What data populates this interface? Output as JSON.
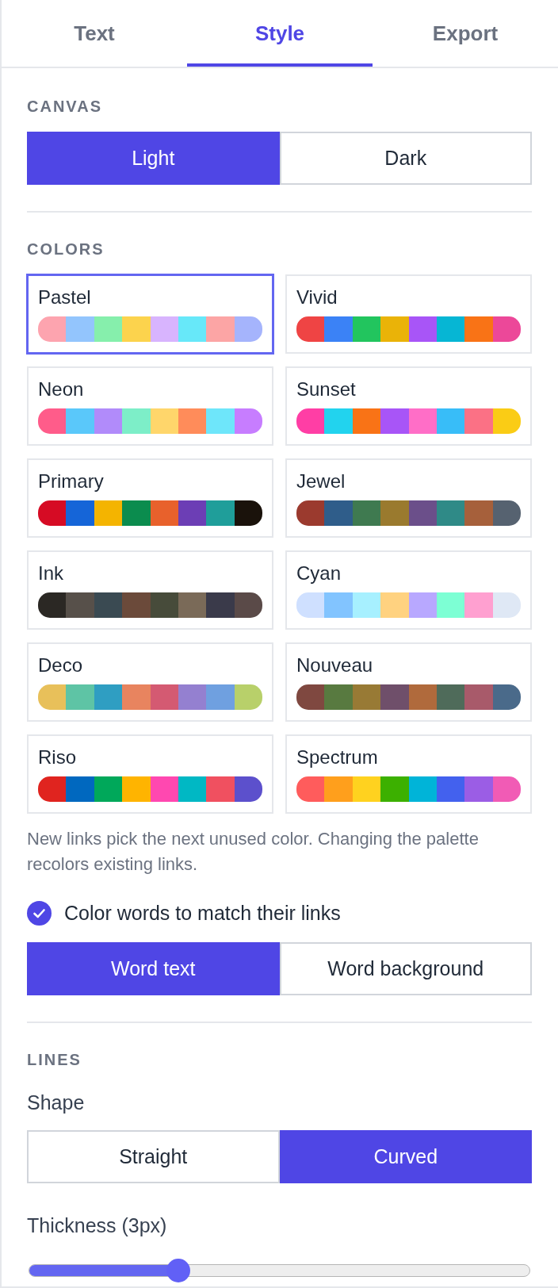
{
  "tabs": [
    {
      "label": "Text",
      "selected": false
    },
    {
      "label": "Style",
      "selected": true
    },
    {
      "label": "Export",
      "selected": false
    }
  ],
  "canvas": {
    "heading": "CANVAS",
    "options": [
      {
        "label": "Light",
        "selected": true
      },
      {
        "label": "Dark",
        "selected": false
      }
    ]
  },
  "colors": {
    "heading": "COLORS",
    "palettes": [
      {
        "name": "Pastel",
        "selected": true,
        "swatches": [
          {
            "color": "#fda4af"
          },
          {
            "color": "#93c5fd"
          },
          {
            "color": "#86efac"
          },
          {
            "color": "#fcd34d"
          },
          {
            "color": "#d8b4fe"
          },
          {
            "color": "#67e8f9"
          },
          {
            "color": "#fca5a5"
          },
          {
            "color": "#a5b4fc"
          }
        ]
      },
      {
        "name": "Vivid",
        "selected": false,
        "swatches": [
          {
            "color": "#ef4444"
          },
          {
            "color": "#3b82f6"
          },
          {
            "color": "#22c55e"
          },
          {
            "color": "#eab308"
          },
          {
            "color": "#a855f7"
          },
          {
            "color": "#06b6d4"
          },
          {
            "color": "#f97316"
          },
          {
            "color": "#ec4899"
          }
        ]
      },
      {
        "name": "Neon",
        "selected": false,
        "swatches": [
          {
            "color": "#ff5c8a"
          },
          {
            "color": "#5ac8fa"
          },
          {
            "color": "#b18bfa"
          },
          {
            "color": "#7deec8"
          },
          {
            "color": "#ffd66b"
          },
          {
            "color": "#ff8c5a"
          },
          {
            "color": "#6ee6fa"
          },
          {
            "color": "#c77dff"
          }
        ]
      },
      {
        "name": "Sunset",
        "selected": false,
        "swatches": [
          {
            "color": "#ff3ea5"
          },
          {
            "color": "#22d3ee"
          },
          {
            "color": "#f97316"
          },
          {
            "color": "#a855f7"
          },
          {
            "color": "#ff6ec7"
          },
          {
            "color": "#38bdf8"
          },
          {
            "color": "#fb7185"
          },
          {
            "color": "#facc15"
          }
        ]
      },
      {
        "name": "Primary",
        "selected": false,
        "swatches": [
          {
            "color": "#d60b24"
          },
          {
            "color": "#1565d8"
          },
          {
            "color": "#f4b400"
          },
          {
            "color": "#0b8c4e"
          },
          {
            "color": "#e8612c"
          },
          {
            "color": "#6c3eb5"
          },
          {
            "color": "#1f9e9a"
          },
          {
            "color": "#1a120b"
          }
        ]
      },
      {
        "name": "Jewel",
        "selected": false,
        "swatches": [
          {
            "color": "#9b3a2e"
          },
          {
            "color": "#2f5d8a"
          },
          {
            "color": "#3f7a50"
          },
          {
            "color": "#9a7a2e"
          },
          {
            "color": "#6b4f8a"
          },
          {
            "color": "#2f8a87"
          },
          {
            "color": "#a6603b"
          },
          {
            "color": "#566270"
          }
        ]
      },
      {
        "name": "Ink",
        "selected": false,
        "swatches": [
          {
            "color": "#2b2824"
          },
          {
            "color": "#57504a"
          },
          {
            "color": "#3a4a52"
          },
          {
            "color": "#6b4a3a"
          },
          {
            "color": "#474b3a"
          },
          {
            "color": "#7a6a58"
          },
          {
            "color": "#3a3a4a"
          },
          {
            "color": "#5a4a48"
          }
        ]
      },
      {
        "name": "Cyan",
        "selected": false,
        "swatches": [
          {
            "color": "#cfe0ff"
          },
          {
            "color": "#82c4ff"
          },
          {
            "color": "#a7f0ff"
          },
          {
            "color": "#ffd280"
          },
          {
            "color": "#b8a8ff"
          },
          {
            "color": "#7dffd4"
          },
          {
            "color": "#ffa0d0"
          },
          {
            "color": "#dfe8f5"
          }
        ]
      },
      {
        "name": "Deco",
        "selected": false,
        "swatches": [
          {
            "color": "#e8c05a"
          },
          {
            "color": "#5ec4a5"
          },
          {
            "color": "#2f9ec2"
          },
          {
            "color": "#e8845f"
          },
          {
            "color": "#d45a72"
          },
          {
            "color": "#9480d0"
          },
          {
            "color": "#6fa0e0"
          },
          {
            "color": "#b8d06a"
          }
        ]
      },
      {
        "name": "Nouveau",
        "selected": false,
        "swatches": [
          {
            "color": "#7f4840"
          },
          {
            "color": "#587a40"
          },
          {
            "color": "#987a35"
          },
          {
            "color": "#6f4f6a"
          },
          {
            "color": "#b06a3c"
          },
          {
            "color": "#4f6b5a"
          },
          {
            "color": "#a85a6a"
          },
          {
            "color": "#4a6a8a"
          }
        ]
      },
      {
        "name": "Riso",
        "selected": false,
        "swatches": [
          {
            "color": "#e0241f"
          },
          {
            "color": "#0068bf"
          },
          {
            "color": "#00a85a"
          },
          {
            "color": "#ffb400"
          },
          {
            "color": "#ff48b0"
          },
          {
            "color": "#00b8c4"
          },
          {
            "color": "#f05060"
          },
          {
            "color": "#5c50cc"
          }
        ]
      },
      {
        "name": "Spectrum",
        "selected": false,
        "swatches": [
          {
            "color": "#ff5c5c"
          },
          {
            "color": "#ff9f1c"
          },
          {
            "color": "#ffd21f"
          },
          {
            "color": "#3cb000"
          },
          {
            "color": "#00b4d8"
          },
          {
            "color": "#4361ee"
          },
          {
            "color": "#9b5de5"
          },
          {
            "color": "#f15bb5"
          }
        ]
      }
    ],
    "hint": "New links pick the next unused color. Changing the palette recolors existing links.",
    "match_words": {
      "label": "Color words to match their links",
      "checked": true
    },
    "word_modes": [
      {
        "label": "Word text",
        "selected": true
      },
      {
        "label": "Word background",
        "selected": false
      }
    ]
  },
  "lines": {
    "heading": "LINES",
    "shape": {
      "label": "Shape",
      "options": [
        {
          "label": "Straight",
          "selected": false
        },
        {
          "label": "Curved",
          "selected": true
        }
      ]
    },
    "thickness": {
      "label": "Thickness (3px)",
      "level": 0.29
    }
  }
}
